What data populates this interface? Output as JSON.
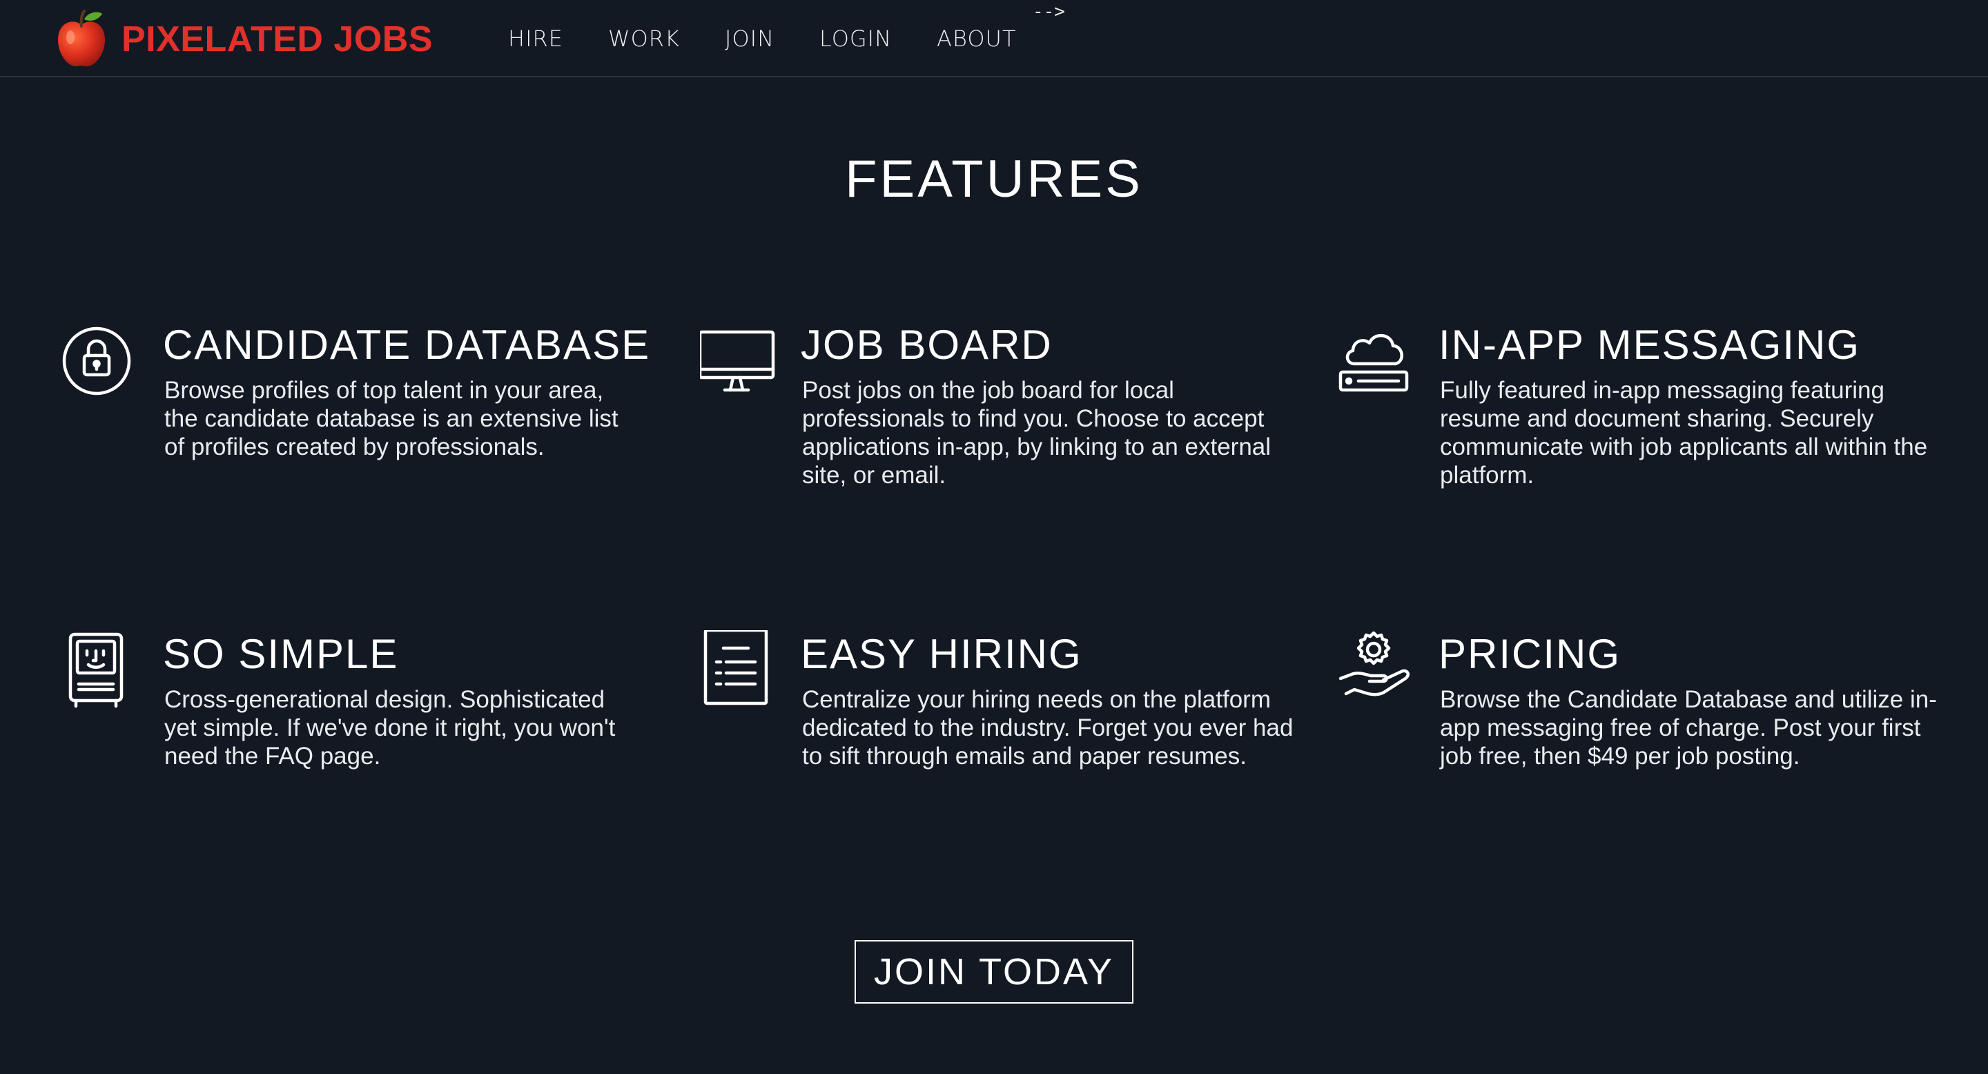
{
  "brand": {
    "name": "PIXELATED JOBS",
    "color": "#e2312a",
    "logo_icon": "apple-icon"
  },
  "nav": {
    "items": [
      {
        "label": "HIRE"
      },
      {
        "label": "WORK"
      },
      {
        "label": "JOIN"
      },
      {
        "label": "LOGIN"
      },
      {
        "label": "ABOUT"
      }
    ]
  },
  "stray_text": "-->",
  "section": {
    "title": "FEATURES"
  },
  "features": [
    {
      "icon": "lock-icon",
      "title": "CANDIDATE DATABASE",
      "description": "Browse profiles of top talent in your area, the candidate database is an extensive list of profiles created by professionals."
    },
    {
      "icon": "monitor-icon",
      "title": "JOB BOARD",
      "description": "Post jobs on the job board for local professionals to find you. Choose to accept applications in-app, by linking to an external site, or email."
    },
    {
      "icon": "cloud-server-icon",
      "title": "IN-APP MESSAGING",
      "description": "Fully featured in-app messaging featuring resume and document sharing. Securely communicate with job applicants all within the platform."
    },
    {
      "icon": "classic-computer-icon",
      "title": "SO SIMPLE",
      "description": "Cross-generational design. Sophisticated yet simple. If we've done it right, you won't need the FAQ page."
    },
    {
      "icon": "document-list-icon",
      "title": "EASY HIRING",
      "description": "Centralize your hiring needs on the platform dedicated to the industry. Forget you ever had to sift through emails and paper resumes."
    },
    {
      "icon": "gear-hand-icon",
      "title": "PRICING",
      "description": "Browse the Candidate Database and utilize in-app messaging free of charge. Post your first job free, then $49 per job posting."
    }
  ],
  "cta": {
    "label": "JOIN TODAY"
  },
  "colors": {
    "background": "#131923",
    "text": "#ffffff",
    "divider": "#2b323d"
  }
}
